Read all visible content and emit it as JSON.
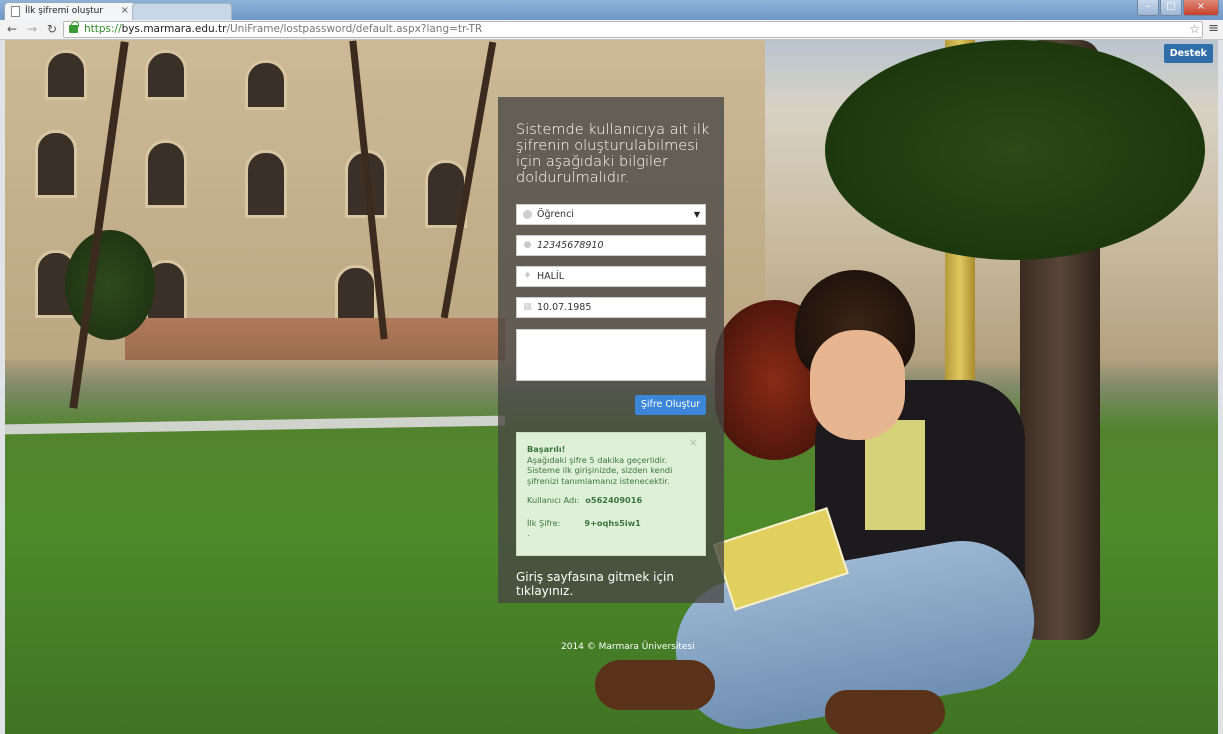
{
  "browser": {
    "tab_title": "İlk şifremi oluştur",
    "tab_close": "×",
    "url_https": "https://",
    "url_host": "bys.marmara.edu.tr",
    "url_path": "/UniFrame/lostpassword/default.aspx?lang=tr-TR",
    "window_buttons": [
      "–",
      "□",
      "×"
    ]
  },
  "page": {
    "support_button": "Destek",
    "heading": "Sistemde kullanıcıya ait ilk şifrenin oluşturulabilmesi için aşağıdaki bilgiler doldurulmalıdır.",
    "form": {
      "user_type": "Öğrenci",
      "id_number": "12345678910",
      "name": "HALİL",
      "birth_date": "10.07.1985",
      "captcha_value": "",
      "submit_label": "Şifre Oluştur"
    },
    "success": {
      "title": "Başarılı!",
      "line1": "Aşağıdaki şifre 5 dakika geçerlidir.",
      "line2": "Sisteme ilk girişinizde, sizden kendi şifrenizi tanımlamanız istenecektir.",
      "username_label": "Kullanıcı Adı:",
      "username_value": "o562409016",
      "password_label": "İlk Şifre:",
      "password_value": "9+oqhs5iw1",
      "dot": ".",
      "close": "×"
    },
    "login_link": "Giriş sayfasına gitmek için tıklayınız.",
    "footer": "2014 © Marmara Üniversitesi"
  },
  "colors": {
    "submit": "#3b86d8",
    "support": "#2f6ea8",
    "success_bg": "#dff0d8",
    "success_text": "#3c763d"
  },
  "icons": [
    "page-icon",
    "back-icon",
    "forward-icon",
    "reload-icon",
    "lock-icon",
    "star-icon",
    "menu-icon",
    "radio-icon",
    "user-icon",
    "person-icon",
    "calendar-icon",
    "close-icon"
  ]
}
